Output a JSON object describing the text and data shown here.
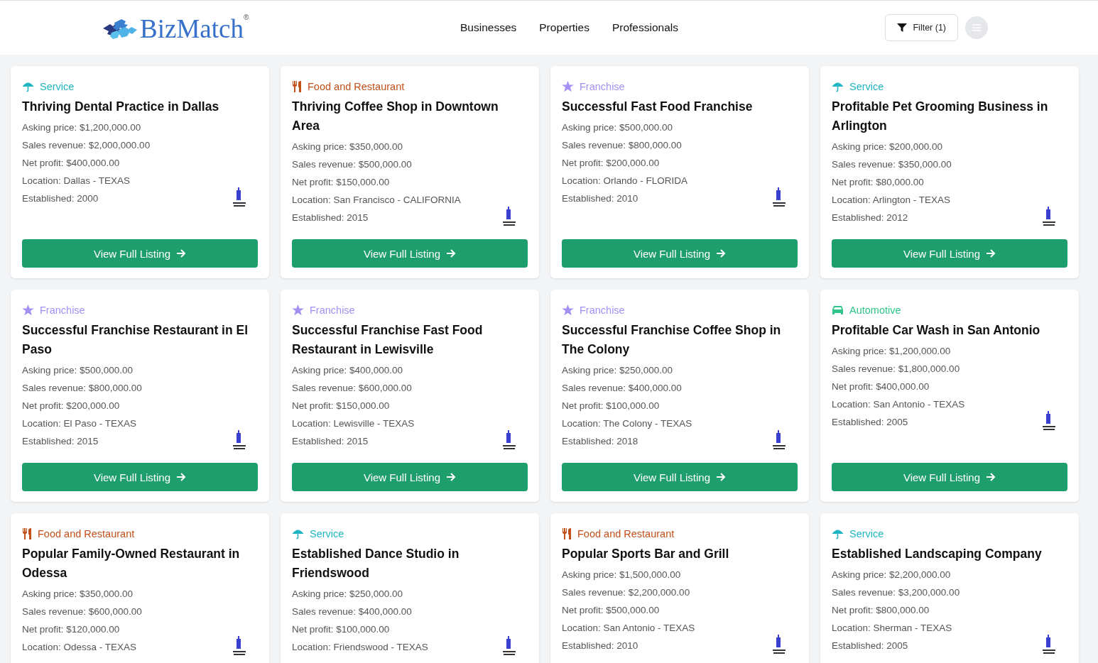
{
  "header": {
    "logo": "BizMatch",
    "logo_mark": "®",
    "nav": [
      "Businesses",
      "Properties",
      "Professionals"
    ],
    "filter_button": "Filter (1)"
  },
  "listings": [
    {
      "category": {
        "kind": "service",
        "label": "Service",
        "color": "#1fb5c2"
      },
      "title": "Thriving Dental Practice in Dallas",
      "details": [
        "Asking price: $1,200,000.00",
        "Sales revenue: $2,000,000.00",
        "Net profit: $400,000.00",
        "Location: Dallas - TEXAS",
        "Established: 2000"
      ],
      "button": "View Full Listing"
    },
    {
      "category": {
        "kind": "food",
        "label": "Food and Restaurant",
        "color": "#c2501a"
      },
      "title": "Thriving Coffee Shop in Downtown Area",
      "details": [
        "Asking price: $350,000.00",
        "Sales revenue: $500,000.00",
        "Net profit: $150,000.00",
        "Location: San Francisco - CALIFORNIA",
        "Established: 2015"
      ],
      "button": "View Full Listing"
    },
    {
      "category": {
        "kind": "franchise",
        "label": "Franchise",
        "color": "#a48ff2"
      },
      "title": "Successful Fast Food Franchise",
      "details": [
        "Asking price: $500,000.00",
        "Sales revenue: $800,000.00",
        "Net profit: $200,000.00",
        "Location: Orlando - FLORIDA",
        "Established: 2010"
      ],
      "button": "View Full Listing"
    },
    {
      "category": {
        "kind": "service",
        "label": "Service",
        "color": "#1fb5c2"
      },
      "title": "Profitable Pet Grooming Business in Arlington",
      "details": [
        "Asking price: $200,000.00",
        "Sales revenue: $350,000.00",
        "Net profit: $80,000.00",
        "Location: Arlington - TEXAS",
        "Established: 2012"
      ],
      "button": "View Full Listing"
    },
    {
      "category": {
        "kind": "franchise",
        "label": "Franchise",
        "color": "#a48ff2"
      },
      "title": "Successful Franchise Restaurant in El Paso",
      "details": [
        "Asking price: $500,000.00",
        "Sales revenue: $800,000.00",
        "Net profit: $200,000.00",
        "Location: El Paso - TEXAS",
        "Established: 2015"
      ],
      "button": "View Full Listing"
    },
    {
      "category": {
        "kind": "franchise",
        "label": "Franchise",
        "color": "#a48ff2"
      },
      "title": "Successful Franchise Fast Food Restaurant in Lewisville",
      "details": [
        "Asking price: $400,000.00",
        "Sales revenue: $600,000.00",
        "Net profit: $150,000.00",
        "Location: Lewisville - TEXAS",
        "Established: 2015"
      ],
      "button": "View Full Listing"
    },
    {
      "category": {
        "kind": "franchise",
        "label": "Franchise",
        "color": "#a48ff2"
      },
      "title": "Successful Franchise Coffee Shop in The Colony",
      "details": [
        "Asking price: $250,000.00",
        "Sales revenue: $400,000.00",
        "Net profit: $100,000.00",
        "Location: The Colony - TEXAS",
        "Established: 2018"
      ],
      "button": "View Full Listing"
    },
    {
      "category": {
        "kind": "automotive",
        "label": "Automotive",
        "color": "#2fc48a"
      },
      "title": "Profitable Car Wash in San Antonio",
      "details": [
        "Asking price: $1,200,000.00",
        "Sales revenue: $1,800,000.00",
        "Net profit: $400,000.00",
        "Location: San Antonio - TEXAS",
        "Established: 2005"
      ],
      "button": "View Full Listing"
    },
    {
      "category": {
        "kind": "food",
        "label": "Food and Restaurant",
        "color": "#c2501a"
      },
      "title": "Popular Family-Owned Restaurant in Odessa",
      "details": [
        "Asking price: $350,000.00",
        "Sales revenue: $600,000.00",
        "Net profit: $120,000.00",
        "Location: Odessa - TEXAS"
      ]
    },
    {
      "category": {
        "kind": "service",
        "label": "Service",
        "color": "#1fb5c2"
      },
      "title": "Established Dance Studio in Friendswood",
      "details": [
        "Asking price: $250,000.00",
        "Sales revenue: $400,000.00",
        "Net profit: $100,000.00",
        "Location: Friendswood - TEXAS"
      ]
    },
    {
      "category": {
        "kind": "food",
        "label": "Food and Restaurant",
        "color": "#c2501a"
      },
      "title": "Popular Sports Bar and Grill",
      "details": [
        "Asking price: $1,500,000.00",
        "Sales revenue: $2,200,000.00",
        "Net profit: $500,000.00",
        "Location: San Antonio - TEXAS",
        "Established: 2010"
      ]
    },
    {
      "category": {
        "kind": "service",
        "label": "Service",
        "color": "#1fb5c2"
      },
      "title": "Established Landscaping Company",
      "details": [
        "Asking price: $2,200,000.00",
        "Sales revenue: $3,200,000.00",
        "Net profit: $800,000.00",
        "Location: Sherman - TEXAS",
        "Established: 2005"
      ]
    }
  ]
}
